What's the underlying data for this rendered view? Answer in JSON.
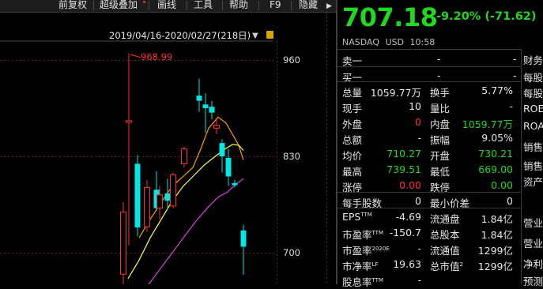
{
  "toolbar": {
    "items": [
      "前复权",
      "超级叠加",
      "画线",
      "工具",
      "帮助",
      "F9",
      "隐藏"
    ]
  },
  "chart": {
    "range_label": "2019/04/16-2020/02/27(218日)",
    "high_annotation": "968.99",
    "y_ticks": [
      "960",
      "830",
      "700"
    ],
    "colors": {
      "up": "#ff3030",
      "down": "#00e5e5",
      "ma5": "#ff9900",
      "ma10": "#ffff33",
      "ma20": "#e040e0"
    }
  },
  "chart_data": {
    "type": "candlestick",
    "y_ticks": [
      960,
      830,
      700
    ],
    "annotations": [
      {
        "label": "968.99",
        "kind": "period-high"
      }
    ],
    "candles": [
      {
        "o": 671,
        "c": 755,
        "h": 768,
        "l": 655,
        "dir": "up"
      },
      {
        "o": 878,
        "c": 878,
        "h": 969,
        "l": 710,
        "dir": "up"
      },
      {
        "o": 820,
        "c": 734,
        "h": 832,
        "l": 722,
        "dir": "down"
      },
      {
        "o": 735,
        "c": 788,
        "h": 798,
        "l": 728,
        "dir": "up"
      },
      {
        "o": 785,
        "c": 760,
        "h": 810,
        "l": 756,
        "dir": "down"
      },
      {
        "o": 760,
        "c": 778,
        "h": 790,
        "l": 745,
        "dir": "up"
      },
      {
        "o": 780,
        "c": 770,
        "h": 800,
        "l": 758,
        "dir": "down"
      },
      {
        "o": 763,
        "c": 805,
        "h": 808,
        "l": 760,
        "dir": "up"
      },
      {
        "o": 820,
        "c": 840,
        "h": 843,
        "l": 815,
        "dir": "up"
      },
      {
        "o": 912,
        "c": 905,
        "h": 935,
        "l": 890,
        "dir": "down"
      },
      {
        "o": 900,
        "c": 895,
        "h": 915,
        "l": 862,
        "dir": "down"
      },
      {
        "o": 897,
        "c": 889,
        "h": 905,
        "l": 880,
        "dir": "down"
      },
      {
        "o": 868,
        "c": 872,
        "h": 882,
        "l": 860,
        "dir": "up"
      },
      {
        "o": 848,
        "c": 830,
        "h": 853,
        "l": 808,
        "dir": "down"
      },
      {
        "o": 828,
        "c": 803,
        "h": 840,
        "l": 790,
        "dir": "down"
      },
      {
        "o": 794,
        "c": 791,
        "h": 798,
        "l": 788,
        "dir": "down"
      },
      {
        "o": 730,
        "c": 708,
        "h": 738,
        "l": 670,
        "dir": "down"
      }
    ],
    "ma_lines": [
      {
        "name": "MA5",
        "values": [
          720,
          745,
          768,
          790,
          803,
          815,
          840,
          868,
          883,
          875,
          860,
          845,
          825
        ]
      },
      {
        "name": "MA10",
        "values": [
          665,
          690,
          720,
          745,
          770,
          790,
          805,
          818,
          828,
          838,
          846,
          845,
          838
        ]
      },
      {
        "name": "MA20",
        "values": [
          640,
          660,
          680,
          700,
          720,
          740,
          760,
          775,
          782,
          792,
          800
        ]
      }
    ]
  },
  "quote": {
    "price": "707.18",
    "change": "-9.20% (-71.62)",
    "exchange": "NASDAQ",
    "currency": "USD",
    "time": "10:58",
    "sell1_label": "卖一",
    "sell1_price": "-",
    "sell1_vol": "-",
    "buy1_label": "买一",
    "buy1_price": "-",
    "buy1_vol": "-",
    "rows": [
      {
        "l1": "总量",
        "v1": "1059.77万",
        "c1": "white",
        "l2": "换手",
        "v2": "5.77%",
        "c2": "white"
      },
      {
        "l1": "现手",
        "v1": "10",
        "c1": "white",
        "l2": "量比",
        "v2": "-",
        "c2": "white"
      },
      {
        "l1": "外盘",
        "v1": "0",
        "c1": "red",
        "l2": "内盘",
        "v2": "1059.77万",
        "c2": "green"
      },
      {
        "l1": "总额",
        "v1": "-",
        "c1": "white",
        "l2": "振幅",
        "v2": "9.05%",
        "c2": "white"
      },
      {
        "l1": "均价",
        "v1": "710.27",
        "c1": "green",
        "l2": "开盘",
        "v2": "730.21",
        "c2": "green"
      },
      {
        "l1": "最高",
        "v1": "739.51",
        "c1": "green",
        "l2": "最低",
        "v2": "669.00",
        "c2": "green"
      },
      {
        "l1": "涨停",
        "v1": "0.00",
        "c1": "red",
        "l2": "跌停",
        "v2": "0.00",
        "c2": "green"
      }
    ],
    "rows2": [
      {
        "l1": "每手股数",
        "v1": "0",
        "l2": "最小价差",
        "v2": "0"
      }
    ],
    "rows3": [
      {
        "l1": "EPS",
        "sup1": "TTM",
        "v1": "-4.69",
        "l2": "流通盘",
        "v2": "1.84亿"
      },
      {
        "l1": "市盈率",
        "sup1": "TTM",
        "v1": "-150.7",
        "l2": "总股本",
        "v2": "1.84亿"
      },
      {
        "l1": "市盈率",
        "sup1": "2020E",
        "v1": "-",
        "l2": "流通值",
        "v2": "1299亿"
      },
      {
        "l1": "市净率",
        "sup1": "LF",
        "v1": "19.63",
        "l2": "总市值",
        "sup2": "2",
        "v2": "1299亿"
      },
      {
        "l1": "股息率",
        "sup1": "TTM",
        "v1": "-",
        "l2": "",
        "v2": ""
      }
    ]
  },
  "right_column": [
    "财务",
    "每股",
    "每股",
    "ROE",
    "ROA",
    "销售",
    "销售",
    "资产",
    "营业",
    "营业",
    "净利",
    "预测"
  ]
}
